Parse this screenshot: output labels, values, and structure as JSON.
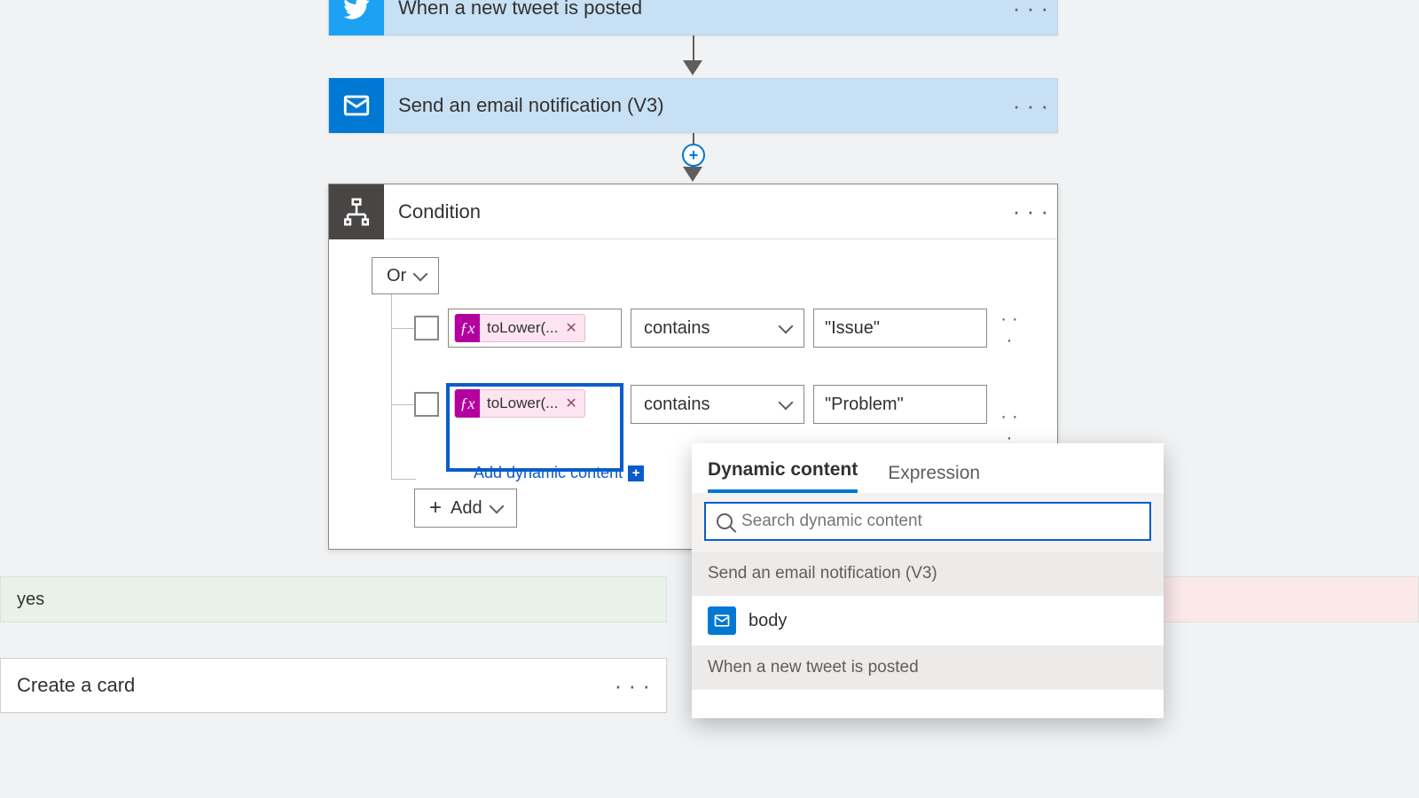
{
  "flow": {
    "trigger": {
      "title": "When a new tweet is posted"
    },
    "email": {
      "title": "Send an email notification (V3)"
    }
  },
  "condition": {
    "title": "Condition",
    "group_operator": "Or",
    "rows": [
      {
        "expr_token": "toLower(...",
        "operator": "contains",
        "value_text": "\"Issue\""
      },
      {
        "expr_token": "toLower(...",
        "operator": "contains",
        "value_text": "\"Problem\""
      }
    ],
    "add_dynamic_label": "Add dynamic content",
    "add_label": "Add"
  },
  "branches": {
    "yes_label": "yes",
    "action_card": "Create a card"
  },
  "flyout": {
    "tabs": {
      "dynamic": "Dynamic content",
      "expression": "Expression"
    },
    "search_placeholder": "Search dynamic content",
    "group1": "Send an email notification (V3)",
    "item1": "body",
    "group2": "When a new tweet is posted"
  }
}
